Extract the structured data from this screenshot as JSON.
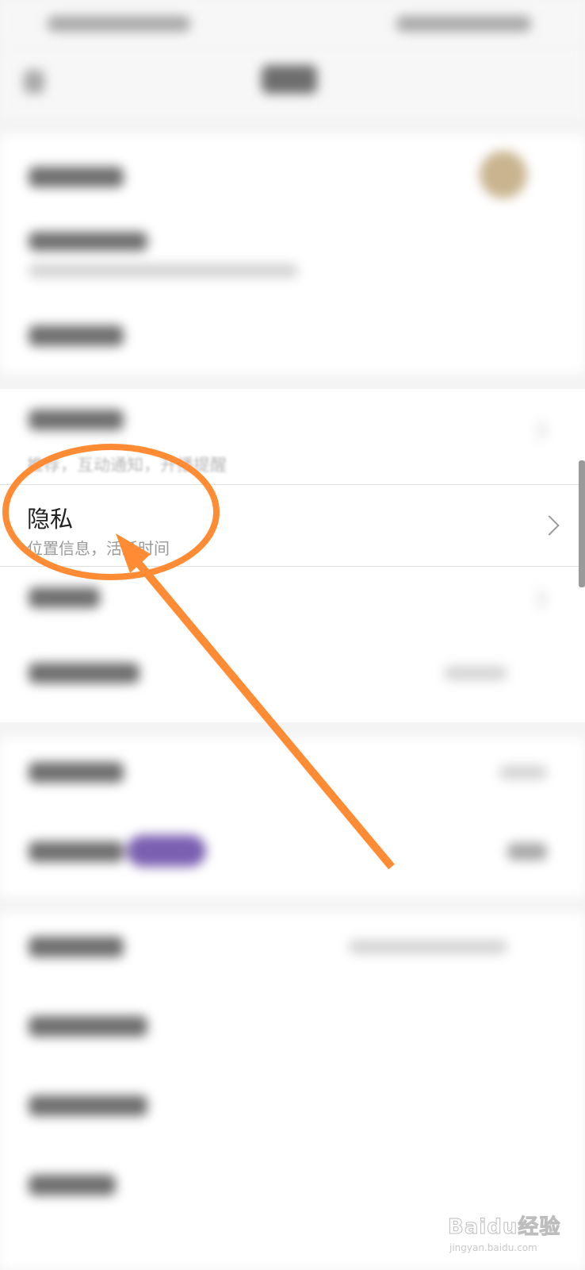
{
  "notifications": {
    "subtitle": "推荐，互动通知，开播提醒"
  },
  "privacy": {
    "title": "隐私",
    "subtitle": "位置信息，活跃时间"
  },
  "watermark": {
    "brand": "Baidu经验",
    "url": "jingyan.baidu.com"
  },
  "annotation": {
    "color": "#ff8c35"
  }
}
